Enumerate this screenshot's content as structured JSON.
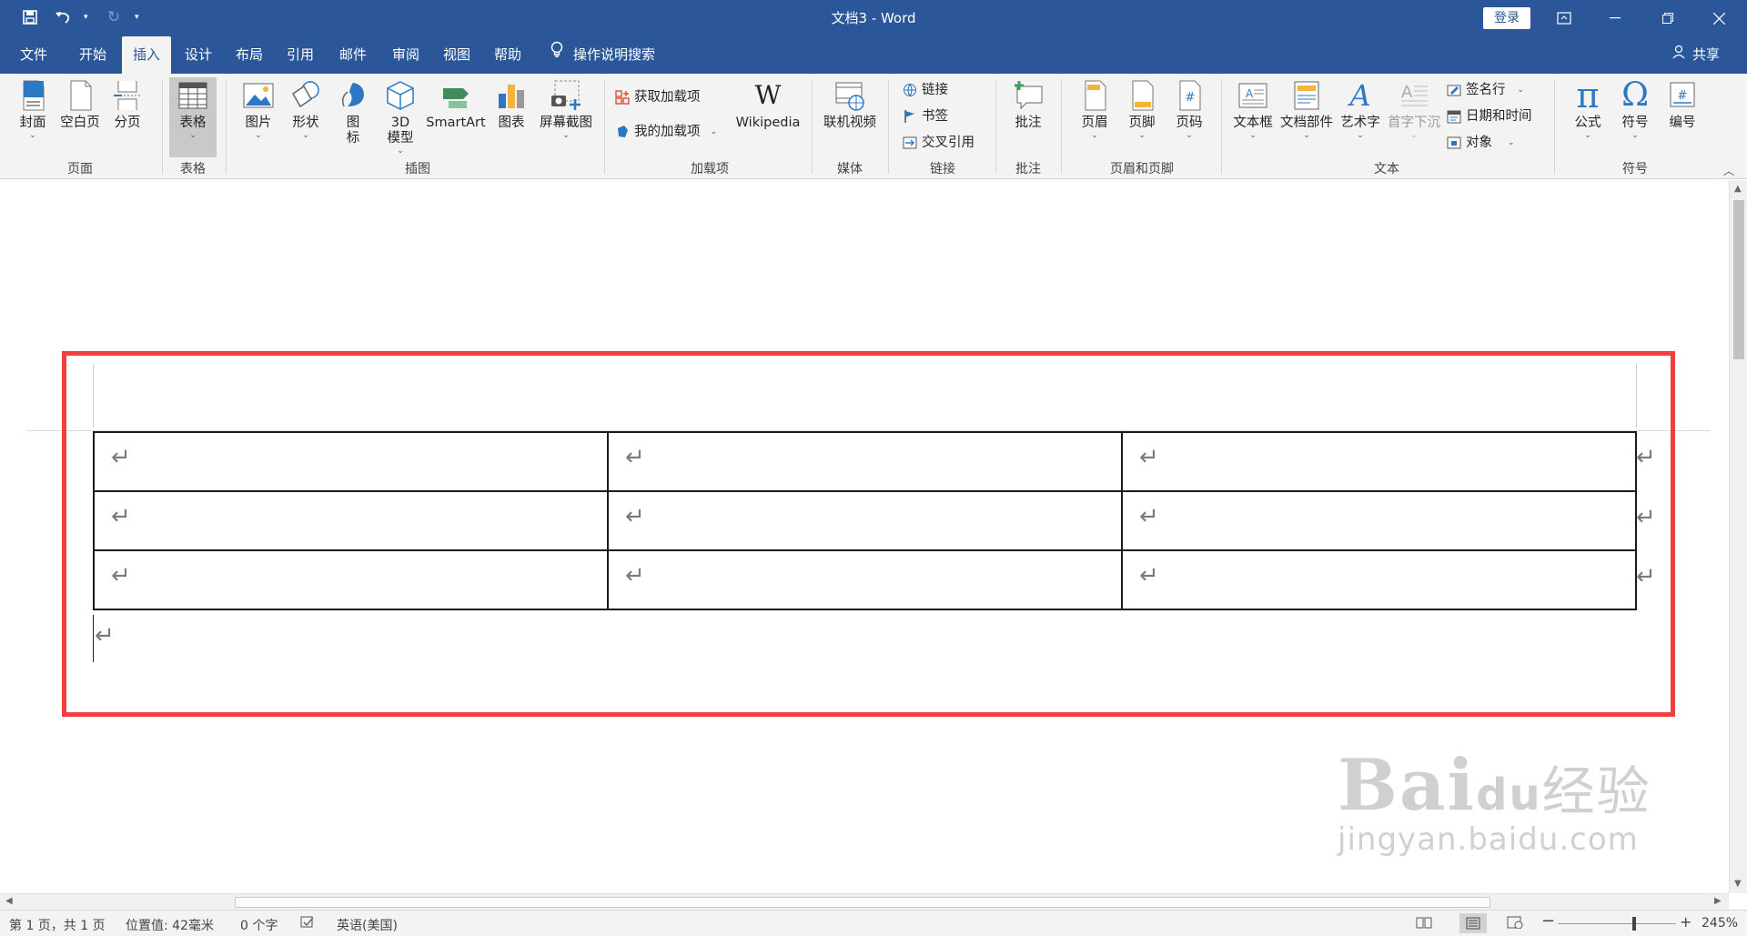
{
  "window": {
    "title": "文档3  -  Word",
    "login_label": "登录"
  },
  "tabs": [
    {
      "label": "文件"
    },
    {
      "label": "开始"
    },
    {
      "label": "插入"
    },
    {
      "label": "设计"
    },
    {
      "label": "布局"
    },
    {
      "label": "引用"
    },
    {
      "label": "邮件"
    },
    {
      "label": "审阅"
    },
    {
      "label": "视图"
    },
    {
      "label": "帮助"
    }
  ],
  "active_tab": "插入",
  "tell_me": "操作说明搜索",
  "share_label": "共享",
  "ribbon": {
    "pages": {
      "cover": "封面",
      "blank": "空白页",
      "break": "分页",
      "group": "页面"
    },
    "tables": {
      "table": "表格",
      "group": "表格"
    },
    "illustrations": {
      "pictures": "图片",
      "shapes": "形状",
      "icons_l1": "图",
      "icons_l2": "标",
      "model_l1": "3D",
      "model_l2": "模型",
      "smartart": "SmartArt",
      "chart": "图表",
      "screenshot": "屏幕截图",
      "group": "插图"
    },
    "addins": {
      "get": "获取加载项",
      "my": "我的加载项",
      "wikipedia": "Wikipedia",
      "group": "加载项"
    },
    "media": {
      "video": "联机视频",
      "group": "媒体"
    },
    "links": {
      "link": "链接",
      "bookmark": "书签",
      "crossref": "交叉引用",
      "group": "链接"
    },
    "comments": {
      "comment": "批注",
      "group": "批注"
    },
    "headerfooter": {
      "header": "页眉",
      "footer": "页脚",
      "pagenum": "页码",
      "group": "页眉和页脚"
    },
    "text": {
      "textbox": "文本框",
      "parts": "文档部件",
      "wordart": "艺术字",
      "dropcap": "首字下沉",
      "signature": "签名行",
      "datetime": "日期和时间",
      "object": "对象",
      "group": "文本"
    },
    "symbols": {
      "equation": "公式",
      "symbol": "符号",
      "number": "编号",
      "group": "符号"
    }
  },
  "document": {
    "table": {
      "rows": 3,
      "cols": 3
    },
    "paragraph_mark": "↵"
  },
  "watermark": {
    "brand": "Bai",
    "brand2": "du",
    "cn": "经验",
    "url": "jingyan.baidu.com"
  },
  "status": {
    "page": "第 1 页，共 1 页",
    "position": "位置值: 42毫米",
    "words": "0 个字",
    "language": "英语(美国)",
    "zoom": "245%",
    "zoom_minus": "−",
    "zoom_plus": "+"
  },
  "colors": {
    "title_bar": "#2b579a",
    "ribbon": "#f3f3f3",
    "highlight": "#ef3f3f"
  }
}
